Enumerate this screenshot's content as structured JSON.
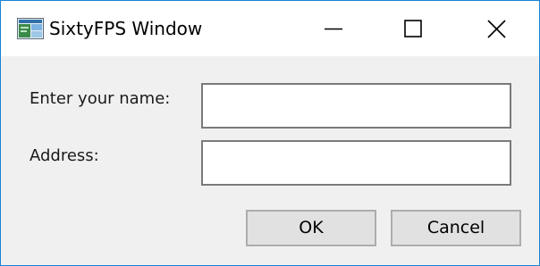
{
  "window": {
    "title": "SixtyFPS Window",
    "accent_border_color": "#1883d7",
    "title_bar_color": "#ffffff",
    "client_area_color": "#f0f0f0"
  },
  "title_bar": {
    "app_icon": "app-window-icon",
    "controls": [
      {
        "icon": "minimize-icon"
      },
      {
        "icon": "maximize-icon"
      },
      {
        "icon": "close-icon"
      }
    ]
  },
  "form": {
    "name_label": "Enter your name:",
    "name_value": "",
    "address_label": "Address:",
    "address_value": ""
  },
  "buttons": {
    "ok_label": "OK",
    "cancel_label": "Cancel"
  }
}
